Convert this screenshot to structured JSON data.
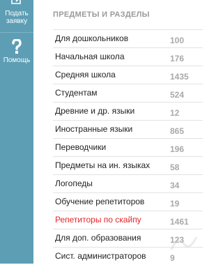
{
  "sidebar": {
    "order": {
      "label_line1": "Подать",
      "label_line2": "заявку",
      "icon": "pencil-edit-icon"
    },
    "help": {
      "label": "Помощь",
      "icon": "question-icon"
    }
  },
  "panel": {
    "heading": "ПРЕДМЕТЫ И РАЗДЕЛЫ",
    "items": [
      {
        "name": "Для дошкольников",
        "count": "100"
      },
      {
        "name": "Начальная школа",
        "count": "176"
      },
      {
        "name": "Средняя школа",
        "count": "1435"
      },
      {
        "name": "Студентам",
        "count": "524"
      },
      {
        "name": "Древние и др. языки",
        "count": "12"
      },
      {
        "name": "Иностранные языки",
        "count": "865"
      },
      {
        "name": "Переводчики",
        "count": "196"
      },
      {
        "name": "Предметы на ин. языках",
        "count": "58"
      },
      {
        "name": "Логопеды",
        "count": "34"
      },
      {
        "name": "Обучение репетиторов",
        "count": "19"
      },
      {
        "name": "Репетиторы по скайпу",
        "count": "1461",
        "accent": true
      },
      {
        "name": "Для доп. образования",
        "count": "123"
      },
      {
        "name": "Сист. администраторов",
        "count": "9"
      }
    ]
  },
  "colors": {
    "sidebar_bg": "#5d9eb5",
    "accent_red": "#e3242b",
    "count_gray": "#a9a9a9"
  }
}
